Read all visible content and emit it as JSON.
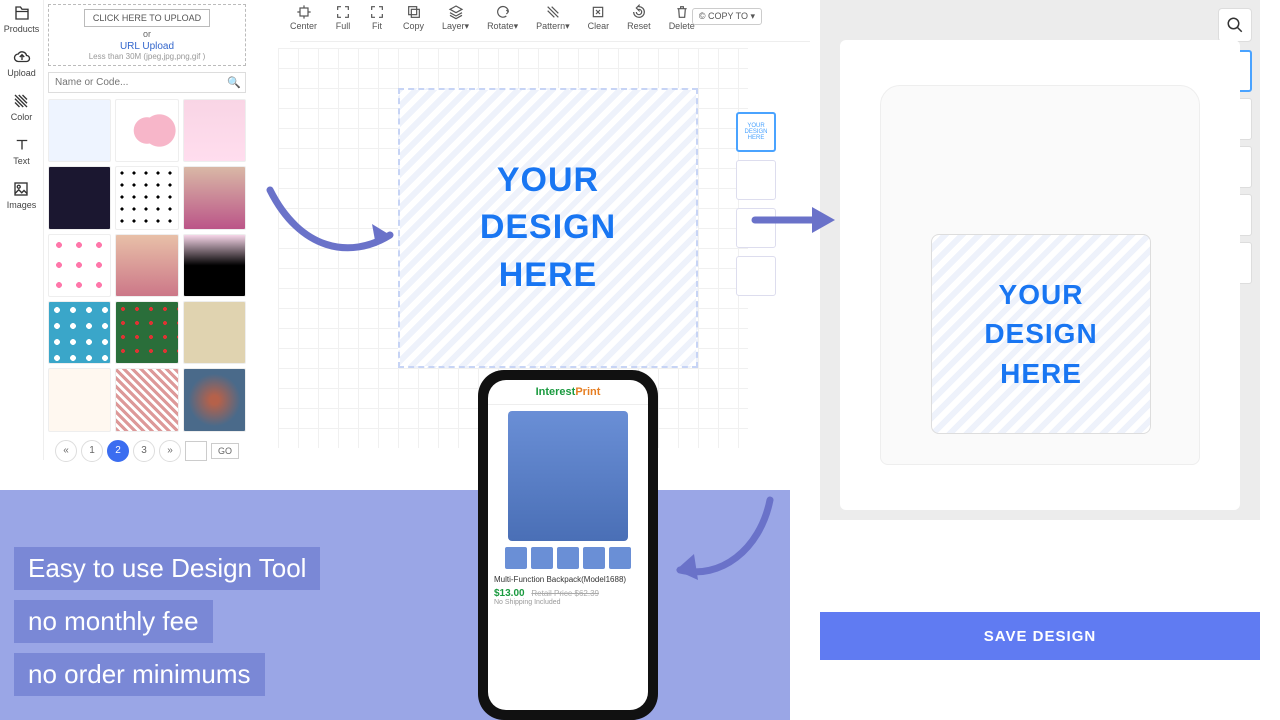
{
  "rail": {
    "products": "Products",
    "upload": "Upload",
    "color": "Color",
    "text": "Text",
    "images": "Images"
  },
  "uploadBox": {
    "click": "CLICK HERE TO UPLOAD",
    "or": "or",
    "url": "URL Upload",
    "hint": "Less than 30M (jpeg,jpg,png,gif )"
  },
  "search": {
    "placeholder": "Name or Code..."
  },
  "pager": {
    "prev": "«",
    "p1": "1",
    "p2": "2",
    "p3": "3",
    "next": "»",
    "go": "GO"
  },
  "toolbar": {
    "center": "Center",
    "full": "Full",
    "fit": "Fit",
    "copy": "Copy",
    "layer": "Layer▾",
    "rotate": "Rotate▾",
    "pattern": "Pattern▾",
    "clear": "Clear",
    "reset": "Reset",
    "delete": "Delete"
  },
  "copyTo": "© COPY TO ▾",
  "design": {
    "l1": "YOUR",
    "l2": "DESIGN",
    "l3": "HERE"
  },
  "slotLabel": "YOUR DESIGN HERE",
  "save": "SAVE DESIGN",
  "promo": {
    "a": "Easy to use Design Tool",
    "b": "no monthly fee",
    "c": "no order minimums"
  },
  "phone": {
    "brand1": "Interest",
    "brand2": "Print",
    "title": "Multi-Function Backpack(Model1688)",
    "price": "$13.00",
    "old": "Retail Price $62.39",
    "ship": "No Shipping Included"
  }
}
